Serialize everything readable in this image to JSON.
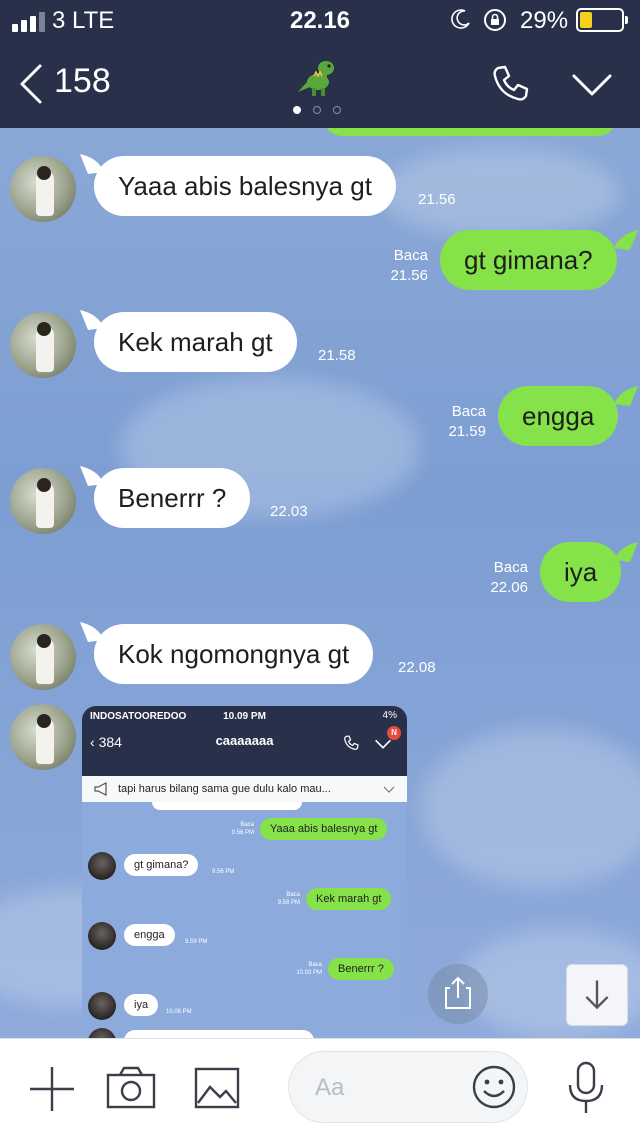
{
  "status_bar": {
    "carrier": "3  LTE",
    "time": "22.16",
    "battery": "29%",
    "battery_level": 0.29
  },
  "header": {
    "back_count": "158",
    "icon": "dinosaur-icon",
    "page_indicator": {
      "count": 3,
      "active": 0
    }
  },
  "messages": [
    {
      "side": "in",
      "text": "Yaaa abis balesnya gt",
      "time": "21.56"
    },
    {
      "side": "out",
      "text": "gt gimana?",
      "read": "Baca",
      "time": "21.56"
    },
    {
      "side": "in",
      "text": "Kek marah gt",
      "time": "21.58"
    },
    {
      "side": "out",
      "text": "engga",
      "read": "Baca",
      "time": "21.59"
    },
    {
      "side": "in",
      "text": "Benerrr ?",
      "time": "22.03"
    },
    {
      "side": "out",
      "text": "iya",
      "read": "Baca",
      "time": "22.06"
    },
    {
      "side": "in",
      "text": "Kok ngomongnya gt",
      "time": "22.08"
    }
  ],
  "embedded_screenshot": {
    "status_left": "INDOSATOOREDOO",
    "time": "10.09 PM",
    "battery": "4%",
    "back_count": "384",
    "title": "caaaaaaa",
    "badge": "N",
    "notice": "tapi harus bilang sama gue dulu kalo mau...",
    "messages": [
      {
        "side": "out",
        "text": "Yaaa abis balesnya gt",
        "read": "Baca",
        "time": "9.56 PM"
      },
      {
        "side": "in",
        "text": "gt gimana?",
        "time": "9.56 PM"
      },
      {
        "side": "out",
        "text": "Kek marah gt",
        "read": "Baca",
        "time": "9.58 PM"
      },
      {
        "side": "in",
        "text": "engga",
        "time": "9.59 PM"
      },
      {
        "side": "out",
        "text": "Benerrr ?",
        "read": "Baca",
        "time": "10.03 PM"
      },
      {
        "side": "in",
        "text": "iya",
        "time": "10.06 PM"
      }
    ]
  },
  "input": {
    "placeholder": "Aa"
  },
  "colors": {
    "header_bg": "#28304a",
    "bubble_out": "#85e249",
    "bubble_in": "#ffffff",
    "chat_bg": "#7d9ed3"
  }
}
